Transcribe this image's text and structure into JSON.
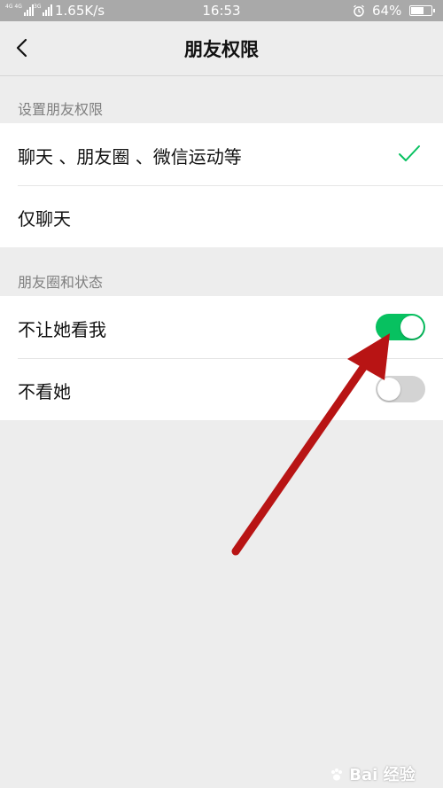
{
  "status_bar": {
    "net_label_1": "4G 4G",
    "net_label_2": "3G",
    "speed": "1.65K/s",
    "time": "16:53",
    "battery": "64%",
    "battery_level": 0.64,
    "icons": [
      "signal-icon",
      "alarm-icon",
      "battery-icon"
    ]
  },
  "nav": {
    "title": "朋友权限",
    "back_icon": "chevron-left-icon"
  },
  "sections": [
    {
      "header": "设置朋友权限",
      "items": [
        {
          "label": "聊天 、朋友圈 、微信运动等",
          "selected": true
        },
        {
          "label": "仅聊天",
          "selected": false
        }
      ]
    },
    {
      "header": "朋友圈和状态",
      "items": [
        {
          "label": "不让她看我",
          "toggle_on": true
        },
        {
          "label": "不看她",
          "toggle_on": false
        }
      ]
    }
  ],
  "colors": {
    "accent_green": "#07c160",
    "toggle_off": "#d3d3d3",
    "annotation_arrow": "#b81414",
    "background": "#ededed"
  },
  "watermark": {
    "text": "Bai 经验",
    "icon": "baidu-paw-icon"
  }
}
